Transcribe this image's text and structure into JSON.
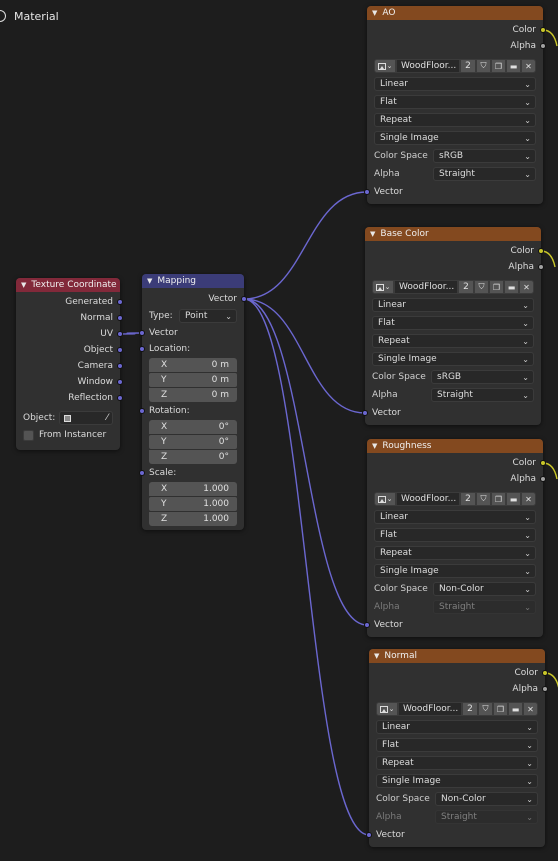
{
  "editor": {
    "title": "Material"
  },
  "texture_coordinate": {
    "title": "Texture Coordinate",
    "outputs": [
      "Generated",
      "Normal",
      "UV",
      "Object",
      "Camera",
      "Window",
      "Reflection"
    ],
    "object_label": "Object:",
    "from_instancer": "From Instancer"
  },
  "mapping": {
    "title": "Mapping",
    "output": "Vector",
    "type_label": "Type:",
    "type_value": "Point",
    "vector_label": "Vector",
    "location_label": "Location:",
    "location": [
      [
        "X",
        "0 m"
      ],
      [
        "Y",
        "0 m"
      ],
      [
        "Z",
        "0 m"
      ]
    ],
    "rotation_label": "Rotation:",
    "rotation": [
      [
        "X",
        "0°"
      ],
      [
        "Y",
        "0°"
      ],
      [
        "Z",
        "0°"
      ]
    ],
    "scale_label": "Scale:",
    "scale": [
      [
        "X",
        "1.000"
      ],
      [
        "Y",
        "1.000"
      ],
      [
        "Z",
        "1.000"
      ]
    ]
  },
  "texture_nodes": [
    {
      "title": "AO",
      "color_label": "Color",
      "alpha_label": "Alpha",
      "image_name": "WoodFloor...",
      "users": "2",
      "interpolation": "Linear",
      "projection": "Flat",
      "extension": "Repeat",
      "source": "Single Image",
      "color_space_label": "Color Space",
      "color_space": "sRGB",
      "alpha_mode_label": "Alpha",
      "alpha_mode": "Straight",
      "alpha_disabled": false,
      "vector_label": "Vector"
    },
    {
      "title": "Base Color",
      "color_label": "Color",
      "alpha_label": "Alpha",
      "image_name": "WoodFloor...",
      "users": "2",
      "interpolation": "Linear",
      "projection": "Flat",
      "extension": "Repeat",
      "source": "Single Image",
      "color_space_label": "Color Space",
      "color_space": "sRGB",
      "alpha_mode_label": "Alpha",
      "alpha_mode": "Straight",
      "alpha_disabled": false,
      "vector_label": "Vector"
    },
    {
      "title": "Roughness",
      "color_label": "Color",
      "alpha_label": "Alpha",
      "image_name": "WoodFloor...",
      "users": "2",
      "interpolation": "Linear",
      "projection": "Flat",
      "extension": "Repeat",
      "source": "Single Image",
      "color_space_label": "Color Space",
      "color_space": "Non-Color",
      "alpha_mode_label": "Alpha",
      "alpha_mode": "Straight",
      "alpha_disabled": true,
      "vector_label": "Vector"
    },
    {
      "title": "Normal",
      "color_label": "Color",
      "alpha_label": "Alpha",
      "image_name": "WoodFloor...",
      "users": "2",
      "interpolation": "Linear",
      "projection": "Flat",
      "extension": "Repeat",
      "source": "Single Image",
      "color_space_label": "Color Space",
      "color_space": "Non-Color",
      "alpha_mode_label": "Alpha",
      "alpha_mode": "Straight",
      "alpha_disabled": true,
      "vector_label": "Vector"
    }
  ],
  "colors": {
    "wire_vector": "#6b67d0",
    "wire_color": "#c8c629",
    "texture_header": "#83491f",
    "input_header": "#82293a",
    "vector_header": "#3b3c78"
  }
}
